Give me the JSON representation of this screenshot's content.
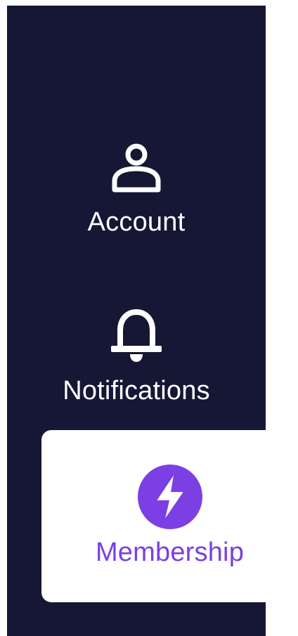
{
  "sidebar": {
    "items": [
      {
        "label": "Account",
        "icon": "user-icon",
        "active": false
      },
      {
        "label": "Notifications",
        "icon": "bell-icon",
        "active": false
      },
      {
        "label": "Membership",
        "icon": "lightning-bolt-icon",
        "active": true
      }
    ]
  },
  "colors": {
    "sidebar_bg": "#151734",
    "text": "#ffffff",
    "accent": "#7b3fe4"
  }
}
